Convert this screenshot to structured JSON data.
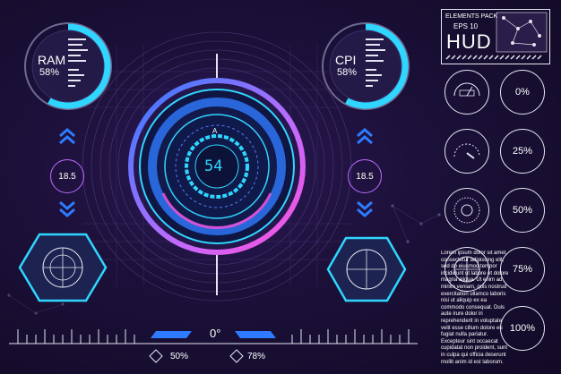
{
  "theme": {
    "accent_cyan": "#2fd6ff",
    "accent_blue": "#2e7bff",
    "accent_magenta": "#ff4fd8",
    "accent_pink": "#c06bff",
    "panel_border": "#e6e6f2",
    "background": "#1b1038"
  },
  "header": {
    "pack_label": "ELEMENTS PACK",
    "eps_label": "EPS 10",
    "title": "HUD"
  },
  "left_gauge": {
    "label": "RAM",
    "percent_text": "58%",
    "level": 0.58
  },
  "right_gauge": {
    "label": "CPI",
    "percent_text": "58%",
    "level": 0.58
  },
  "left_side": {
    "value": "18.5"
  },
  "right_side": {
    "value": "18.5"
  },
  "center": {
    "readout": "54",
    "marker": "A"
  },
  "heading": {
    "value": "0°"
  },
  "bottom": {
    "left_percent": "50%",
    "right_percent": "78%"
  },
  "percent_buttons": [
    "0%",
    "25%",
    "50%",
    "75%",
    "100%"
  ],
  "gauge_icons": [
    "speedometer-icon",
    "tachometer-icon",
    "dial-icon",
    "gridded-dial-icon"
  ],
  "lorem_text": "Lorem ipsum dolor sit amet, consectetur adipiscing elit, sed do eiusmod tempor incididunt ut labore et dolore magna aliqua. Ut enim ad minim veniam, quis nostrud exercitation ullamco laboris nisi ut aliquip ex ea commodo consequat. Duis aute irure dolor in reprehenderit in voluptate velit esse cillum dolore eu fugiat nulla pariatur. Excepteur sint occaecat cupidatat non proident, sunt in culpa qui officia deserunt mollit anim id est laborum."
}
